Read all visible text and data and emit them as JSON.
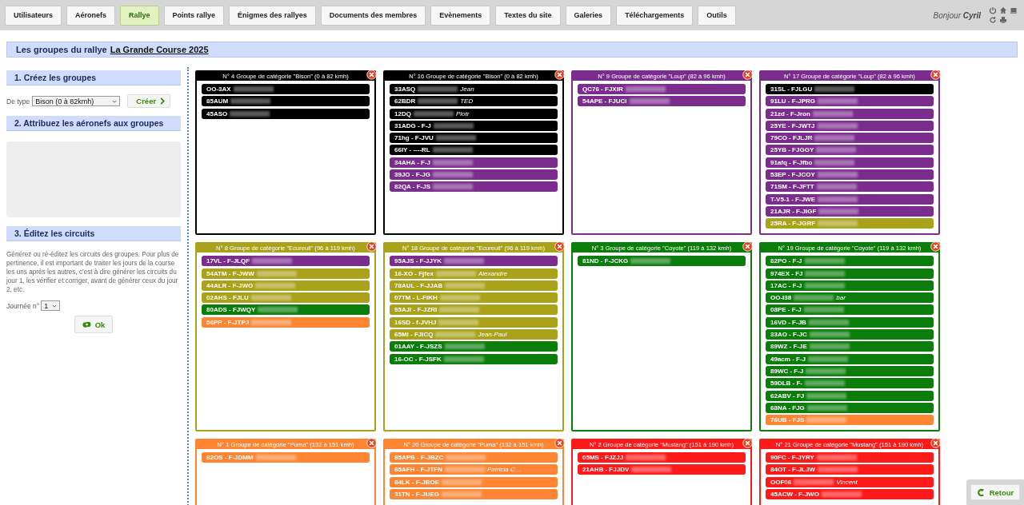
{
  "nav": {
    "tabs": [
      {
        "label": "Utilisateurs",
        "selected": false
      },
      {
        "label": "Aéronefs",
        "selected": false
      },
      {
        "label": "Rallye",
        "selected": true
      },
      {
        "label": "Points rallye",
        "selected": false
      },
      {
        "label": "Énigmes des rallyes",
        "selected": false
      },
      {
        "label": "Documents des membres",
        "selected": false
      },
      {
        "label": "Evènements",
        "selected": false
      },
      {
        "label": "Textes du site",
        "selected": false
      },
      {
        "label": "Galeries",
        "selected": false
      },
      {
        "label": "Téléchargements",
        "selected": false
      },
      {
        "label": "Outils",
        "selected": false
      }
    ],
    "greeting": "Bonjour",
    "user": "Cyril"
  },
  "page_title": {
    "text": "Les groupes du rallye",
    "link": "La Grande Course 2025"
  },
  "sidebar": {
    "create": {
      "heading": "1. Créez les groupes",
      "type_label": "De type",
      "type_value": "Bison (0 à 82kmh)",
      "button": "Créer"
    },
    "assign": {
      "heading": "2. Attribuez les aéronefs aux groupes"
    },
    "circuits": {
      "heading": "3. Éditez les circuits",
      "text": "Générez ou ré-éditez les circuits des groupes. Pour plus de pertinence, il est important de traiter les jours de la course les uns après les autres, c'est à dire générer les circuits du jour 1, les vérifier et corriger, avant de générer ceux du jour 2, etc.",
      "day_label": "Journée n°",
      "day_value": "1",
      "button": "Ok"
    }
  },
  "groups": [
    {
      "title": "N° 4 Groupe de catégorie \"Bison\" (0 à 82 kmh)",
      "color": "#000000",
      "entries": [
        {
          "code": "OO-3AX",
          "color": "#000000"
        },
        {
          "code": "85AUM",
          "color": "#000000"
        },
        {
          "code": "45ASO",
          "color": "#000000"
        }
      ]
    },
    {
      "title": "N° 16 Groupe de catégorie \"Bison\" (0 à 82 kmh)",
      "color": "#000000",
      "entries": [
        {
          "code": "33ASQ",
          "name": "Jean",
          "color": "#000000"
        },
        {
          "code": "62BDR",
          "name": "TED",
          "color": "#000000"
        },
        {
          "code": "12DQ",
          "name": "Piotr",
          "color": "#000000"
        },
        {
          "code": "31ADG - F-J",
          "color": "#000000"
        },
        {
          "code": "71hg - F-JVU",
          "color": "#000000"
        },
        {
          "code": "66IY - ----RL",
          "color": "#000000"
        },
        {
          "code": "34AHA - F-J",
          "color": "#7b2d8e"
        },
        {
          "code": "39JO - F-JG",
          "color": "#7b2d8e"
        },
        {
          "code": "82QA - F-JS",
          "color": "#7b2d8e"
        }
      ]
    },
    {
      "title": "N° 9 Groupe de catégorie \"Loup\" (82 à 96 kmh)",
      "color": "#7b2d8e",
      "entries": [
        {
          "code": "QC76 - FJXIR",
          "color": "#7b2d8e"
        },
        {
          "code": "54APE - FJUCI",
          "color": "#7b2d8e"
        }
      ]
    },
    {
      "title": "N° 17 Groupe de catégorie \"Loup\" (82 à 96 kmh)",
      "color": "#7b2d8e",
      "entries": [
        {
          "code": "31SL - FJLGU",
          "color": "#000000"
        },
        {
          "code": "91LU - F-JPRG",
          "color": "#7b2d8e"
        },
        {
          "code": "21zd - F-Jron",
          "color": "#7b2d8e"
        },
        {
          "code": "25YE - F-JWTJ",
          "color": "#7b2d8e"
        },
        {
          "code": "79CO - FJLJR",
          "color": "#7b2d8e"
        },
        {
          "code": "25YB - FJGGY",
          "color": "#7b2d8e"
        },
        {
          "code": "91afq - F-Jfbo",
          "color": "#7b2d8e"
        },
        {
          "code": "53EP - F-JCOY",
          "color": "#7b2d8e"
        },
        {
          "code": "71SM - F-JFTT",
          "color": "#7b2d8e"
        },
        {
          "code": "T-V5-1 - F-JWE",
          "color": "#7b2d8e"
        },
        {
          "code": "21AJR - F-JIGF",
          "color": "#7b2d8e"
        },
        {
          "code": "25RA - F-JGRF",
          "color": "#a9a21a"
        }
      ]
    },
    {
      "title": "N° 8 Groupe de catégorie \"Ecureuil\" (96 à 119 kmh)",
      "color": "#a9a21a",
      "entries": [
        {
          "code": "17VL - F-JLQF",
          "color": "#7b2d8e"
        },
        {
          "code": "54ATM - F-JWW",
          "color": "#a9a21a"
        },
        {
          "code": "44ALR - F-JWO",
          "color": "#a9a21a"
        },
        {
          "code": "02AHS - FJLU",
          "color": "#a9a21a"
        },
        {
          "code": "80ADS - FJWQY",
          "color": "#0b7d0b"
        },
        {
          "code": "56PP - F-JTPJ",
          "color": "#ff8533"
        }
      ]
    },
    {
      "title": "N° 18 Groupe de catégorie \"Ecureuil\" (96 à 119 kmh)",
      "color": "#a9a21a",
      "entries": [
        {
          "code": "95AJS - F-JJYK",
          "color": "#7b2d8e"
        },
        {
          "code": "16-XO - Fjfex",
          "name": "Alexandre",
          "color": "#a9a21a"
        },
        {
          "code": "78AUL - F-JJAB",
          "color": "#a9a21a"
        },
        {
          "code": "07TM - L-FIKH",
          "color": "#a9a21a"
        },
        {
          "code": "95AJI - F-JZRI",
          "color": "#a9a21a"
        },
        {
          "code": "16SD - f-JVHJ",
          "color": "#a9a21a"
        },
        {
          "code": "65MI - FJICQ",
          "name": "Jean-Paul",
          "color": "#a9a21a"
        },
        {
          "code": "01AAY - F-JSZS",
          "color": "#0b7d0b"
        },
        {
          "code": "16-OC - F-JSFK",
          "color": "#0b7d0b"
        }
      ]
    },
    {
      "title": "N° 3 Groupe de catégorie \"Coyote\" (119 à 132 kmh)",
      "color": "#0b7d0b",
      "entries": [
        {
          "code": "81ND - F-JCKG",
          "color": "#0b7d0b"
        }
      ]
    },
    {
      "title": "N° 19 Groupe de catégorie \"Coyote\" (119 à 132 kmh)",
      "color": "#0b7d0b",
      "entries": [
        {
          "code": "82PO - F-J",
          "color": "#0b7d0b"
        },
        {
          "code": "974EX - FJ",
          "color": "#0b7d0b"
        },
        {
          "code": "17AC - F-J",
          "color": "#0b7d0b"
        },
        {
          "code": "OO-I38",
          "name": "bar",
          "color": "#0b7d0b"
        },
        {
          "code": "08PE - F-J",
          "color": "#0b7d0b"
        },
        {
          "code": "16VD - F-JB",
          "color": "#0b7d0b"
        },
        {
          "code": "33AO - F-JC",
          "color": "#0b7d0b"
        },
        {
          "code": "89WZ - F-JE",
          "color": "#0b7d0b"
        },
        {
          "code": "49acm - F-J",
          "color": "#0b7d0b"
        },
        {
          "code": "89WC - F-J",
          "color": "#0b7d0b"
        },
        {
          "code": "59DLB - F-",
          "color": "#0b7d0b"
        },
        {
          "code": "62ABV - FJ",
          "color": "#0b7d0b"
        },
        {
          "code": "68NA - FJG",
          "color": "#0b7d0b"
        },
        {
          "code": "76UB - FJS",
          "color": "#ff8533"
        }
      ]
    },
    {
      "title": "N° 1 Groupe de catégorie \"Puma\" (132 à 151 kmh)",
      "color": "#ff8533",
      "entries": [
        {
          "code": "82OS - F-JDMM",
          "color": "#ff8533"
        }
      ]
    },
    {
      "title": "N° 20 Groupe de catégorie \"Puma\" (132 à 151 kmh)",
      "color": "#ff8533",
      "entries": [
        {
          "code": "85APB - F-JBZC",
          "color": "#ff8533"
        },
        {
          "code": "85AFH - F-JTFN",
          "name": "Patricia C…",
          "color": "#ff8533"
        },
        {
          "code": "84LK - F-JBOE",
          "color": "#ff8533"
        },
        {
          "code": "31TN - F-JUEG",
          "color": "#ff8533"
        }
      ]
    },
    {
      "title": "N° 2 Groupe de catégorie \"Mustang\" (151 à 190 kmh)",
      "color": "#ff1a1a",
      "entries": [
        {
          "code": "05MS - FJZJJ",
          "color": "#ff1a1a"
        },
        {
          "code": "21AHB - FJJDV",
          "color": "#ff1a1a"
        }
      ]
    },
    {
      "title": "N° 21 Groupe de catégorie \"Mustang\" (151 à 190 kmh)",
      "color": "#ff1a1a",
      "entries": [
        {
          "code": "90FC - F-JYRY",
          "color": "#ff1a1a"
        },
        {
          "code": "84OT - F-JLJW",
          "color": "#ff1a1a"
        },
        {
          "code": "OOF06",
          "name": "Vincent",
          "color": "#ff1a1a"
        },
        {
          "code": "45ACW - F-JWO",
          "color": "#ff1a1a"
        }
      ]
    }
  ],
  "back_button": "Retour"
}
